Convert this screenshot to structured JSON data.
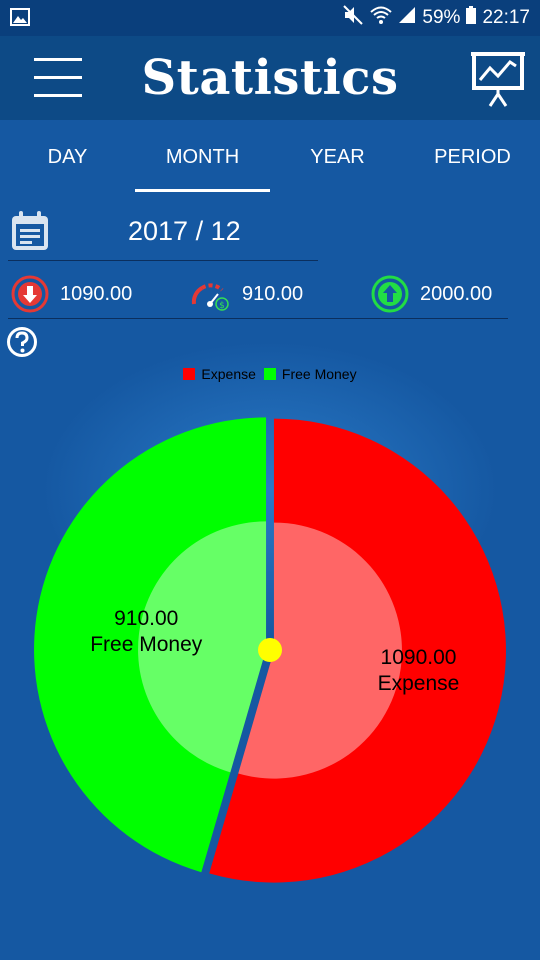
{
  "status_bar": {
    "battery": "59%",
    "time": "22:17"
  },
  "header": {
    "title": "Statistics"
  },
  "tabs": [
    "DAY",
    "MONTH",
    "YEAR",
    "PERIOD"
  ],
  "active_tab": "MONTH",
  "date": "2017 / 12",
  "summary": {
    "expense": "1090.00",
    "free_money": "910.00",
    "income": "2000.00"
  },
  "colors": {
    "expense": "#ff0000",
    "free_money": "#00ff00",
    "center": "#ffff00"
  },
  "chart_data": {
    "type": "pie",
    "categories": [
      "Expense",
      "Free Money"
    ],
    "values": [
      1090.0,
      910.0
    ],
    "value_labels": [
      "1090.00",
      "910.00"
    ],
    "legend": "top"
  }
}
